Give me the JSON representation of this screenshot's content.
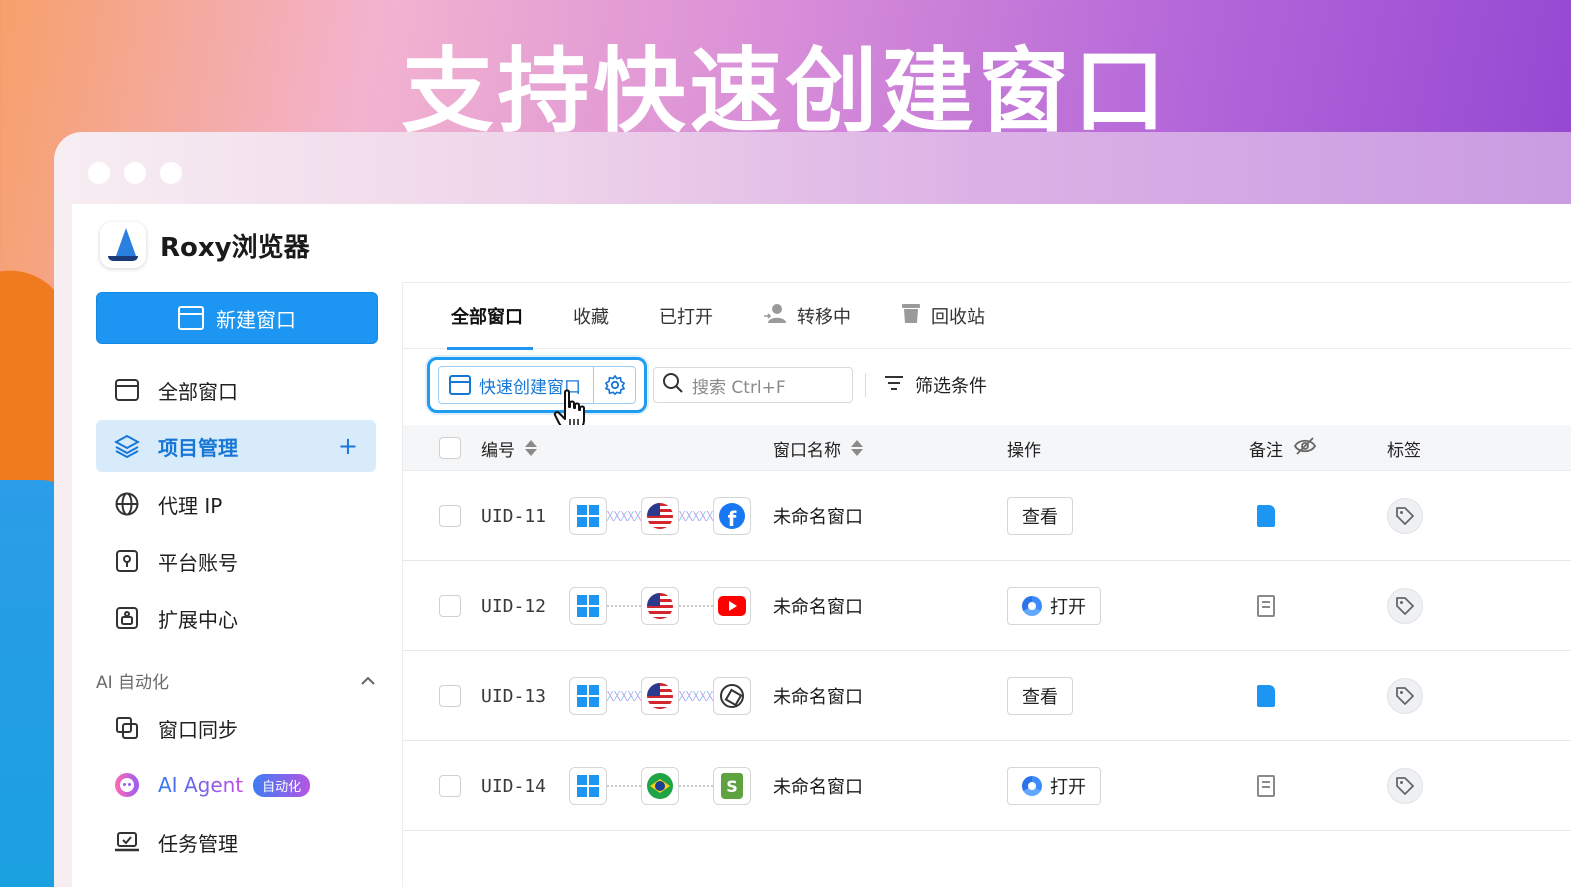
{
  "hero": {
    "title": "支持快速创建窗口"
  },
  "app": {
    "brand_name": "Roxy浏览器",
    "new_window_label": "新建窗口"
  },
  "sidebar": {
    "items": [
      {
        "label": "全部窗口",
        "icon": "window-icon"
      },
      {
        "label": "项目管理",
        "icon": "layers-icon",
        "active": true,
        "action": "+"
      },
      {
        "label": "代理 IP",
        "icon": "globe-icon"
      },
      {
        "label": "平台账号",
        "icon": "key-icon"
      },
      {
        "label": "扩展中心",
        "icon": "puzzle-icon"
      }
    ],
    "ai_section_title": "AI 自动化",
    "ai_items": [
      {
        "label": "窗口同步",
        "icon": "copy-icon"
      },
      {
        "label": "AI Agent",
        "icon": "robot-icon",
        "badge": "自动化"
      },
      {
        "label": "任务管理",
        "icon": "laptop-icon"
      }
    ]
  },
  "tabs": [
    {
      "label": "全部窗口",
      "active": true
    },
    {
      "label": "收藏"
    },
    {
      "label": "已打开"
    },
    {
      "label": "转移中",
      "icon": "user-transfer-icon"
    },
    {
      "label": "回收站",
      "icon": "trash-icon"
    }
  ],
  "toolbar": {
    "quick_create_label": "快速创建窗口",
    "search_placeholder": "搜索  Ctrl+F",
    "filter_label": "筛选条件"
  },
  "table": {
    "columns": {
      "id": "编号",
      "name": "窗口名称",
      "action": "操作",
      "note": "备注",
      "tags": "标签"
    },
    "rows": [
      {
        "uid": "UID-11",
        "os": "windows",
        "country": "US",
        "site": "facebook",
        "link": "active",
        "name": "未命名窗口",
        "action": "查看",
        "action_icon": "",
        "note": "filled"
      },
      {
        "uid": "UID-12",
        "os": "windows",
        "country": "US",
        "site": "youtube",
        "link": "idle",
        "name": "未命名窗口",
        "action": "打开",
        "action_icon": "browser",
        "note": "empty"
      },
      {
        "uid": "UID-13",
        "os": "windows",
        "country": "US",
        "site": "chatgpt",
        "link": "active",
        "name": "未命名窗口",
        "action": "查看",
        "action_icon": "",
        "note": "filled"
      },
      {
        "uid": "UID-14",
        "os": "windows",
        "country": "BR",
        "site": "shopify",
        "link": "idle",
        "name": "未命名窗口",
        "action": "打开",
        "action_icon": "browser",
        "note": "empty"
      }
    ]
  },
  "colors": {
    "accent": "#1d95f3",
    "active_bg": "#d8ebfb"
  }
}
